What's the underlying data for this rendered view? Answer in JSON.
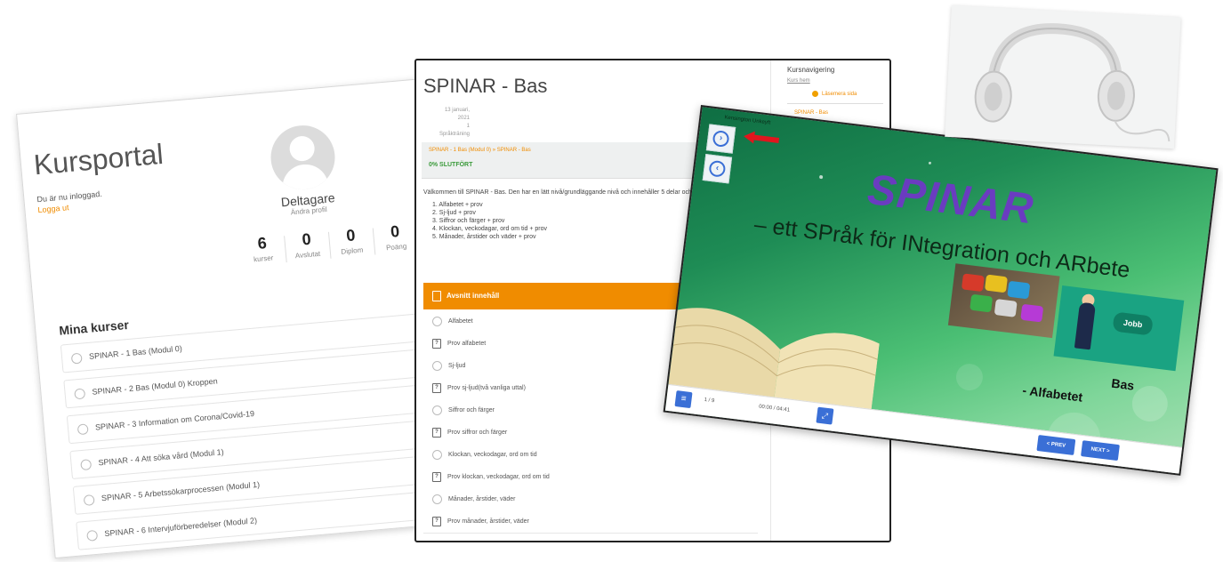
{
  "portal": {
    "title": "Kursportal",
    "logged_in_text": "Du är nu inloggad.",
    "logout_label": "Logga ut",
    "user_name": "Deltagare",
    "edit_profile": "Ändra profil",
    "stats": [
      {
        "value": "6",
        "label": "kurser"
      },
      {
        "value": "0",
        "label": "Avslutat"
      },
      {
        "value": "0",
        "label": "Diplom"
      },
      {
        "value": "0",
        "label": "Poäng"
      }
    ],
    "my_courses_heading": "Mina kurser",
    "courses": [
      "SPINAR - 1 Bas (Modul 0)",
      "SPINAR - 2 Bas (Modul 0) Kroppen",
      "SPINAR - 3 Information om Corona/Covid-19",
      "SPINAR - 4 Att söka vård (Modul 1)",
      "SPINAR - 5 Arbetssökarprocessen (Modul 1)",
      "SPINAR - 6 Intervjuförberedelser (Modul 2)"
    ]
  },
  "bas": {
    "title": "SPINAR - Bas",
    "meta": [
      "13 januari,",
      "2021",
      "1",
      "Språkträning"
    ],
    "breadcrumb": "SPINAR - 1 Bas (Modul 0) » SPINAR - Bas",
    "progress_label": "0% SLUTFÖRT",
    "intro": "Välkommen till SPINAR - Bas. Den har en lätt nivå/grundläggande nivå och innehåller 5 delar och 5 prov:",
    "intro_items": [
      "1. Alfabetet + prov",
      "2. Sj-ljud + prov",
      "3. Siffror och färger + prov",
      "4. Klockan, veckodagar, ord om tid + prov",
      "5. Månader, årstider och väder + prov"
    ],
    "section_label": "Avsnitt innehåll",
    "lessons": [
      {
        "label": "Alfabetet",
        "type": "lesson"
      },
      {
        "label": "Prov alfabetet",
        "type": "quiz"
      },
      {
        "label": "Sj-ljud",
        "type": "lesson"
      },
      {
        "label": "Prov sj-ljud(två vanliga uttal)",
        "type": "quiz"
      },
      {
        "label": "Siffror och färger",
        "type": "lesson"
      },
      {
        "label": "Prov siffror och färger",
        "type": "quiz"
      },
      {
        "label": "Klockan, veckodagar, ord om tid",
        "type": "lesson"
      },
      {
        "label": "Prov klockan, veckodagar, ord om tid",
        "type": "quiz"
      },
      {
        "label": "Månader, årstider, väder",
        "type": "lesson"
      },
      {
        "label": "Prov månader, årstider, väder",
        "type": "quiz"
      }
    ],
    "sidebar": {
      "heading": "Kursnavigering",
      "course_home": "Kurs hem",
      "continue": "Läsemera sida",
      "current": "SPINAR - Bas"
    }
  },
  "slide": {
    "small_title": "Kensington Unkeyft",
    "title": "SPINAR",
    "subtitle": "– ett SPråk för INtegration och ARbete",
    "jobb_label": "Jobb",
    "bas_label": "Bas",
    "alfabetet_label": "- Alfabetet",
    "page_indicator": "1 / 9",
    "time_indicator": "00:00 / 04:41",
    "prev_label": "< PREV",
    "next_label": "NEXT >",
    "colors": {
      "accent_blue": "#3a6fd6",
      "title_purple": "#6a3cc0",
      "orange": "#f08c00"
    }
  }
}
